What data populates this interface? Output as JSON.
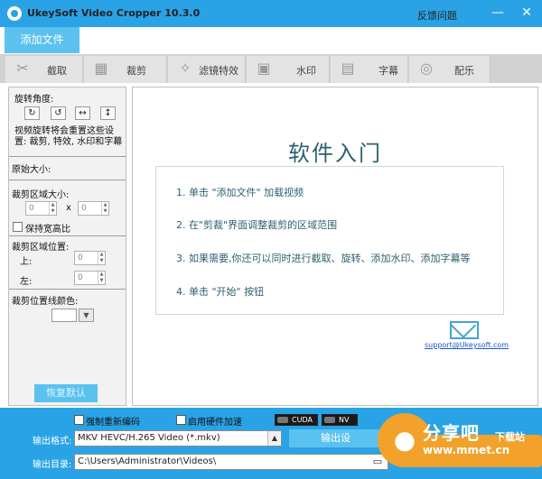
{
  "window": {
    "title": "UkeySoft Video Cropper 10.3.0",
    "feedback": "反馈问题",
    "minimize": "—",
    "close": "✕"
  },
  "toolbar": {
    "add_file": "添加文件"
  },
  "tabs": [
    {
      "label": "截取",
      "icon": "scissors-icon",
      "glyph": "✂"
    },
    {
      "label": "裁剪",
      "icon": "film-crop-icon",
      "glyph": "▦"
    },
    {
      "label": "滤镜特效",
      "icon": "sparkle-icon",
      "glyph": "✧"
    },
    {
      "label": "水印",
      "icon": "watermark-icon",
      "glyph": "▣"
    },
    {
      "label": "字幕",
      "icon": "subtitle-icon",
      "glyph": "▤"
    },
    {
      "label": "配乐",
      "icon": "music-icon",
      "glyph": "◎"
    }
  ],
  "left_panel": {
    "rotate_label": "旋转角度:",
    "rotate_buttons": [
      "↻",
      "↺",
      "↔",
      "↕"
    ],
    "rotate_note": "视频旋转将会重置这些设置: 裁剪, 特效, 水印和字幕",
    "original_size": "原始大小:",
    "crop_size": "裁剪区域大小:",
    "width_value": "0",
    "height_value": "0",
    "times": "x",
    "keep_ratio": "保持宽高比",
    "crop_position": "裁剪区域位置:",
    "top_label": "上:",
    "top_value": "0",
    "left_label": "左:",
    "left_value": "0",
    "line_color": "裁剪位置线颜色:",
    "reset": "恢复默认"
  },
  "intro": {
    "title": "软件入门",
    "steps": [
      "1. 单击 \"添加文件\" 加载视频",
      "2. 在\"剪裁\"界面调整裁剪的区域范围",
      "3. 如果需要,你还可以同时进行截取、旋转、添加水印、添加字幕等",
      "4. 单击 \"开始\" 按钮"
    ],
    "support": "support@Ukeysoft.com"
  },
  "bottom": {
    "force_reencode": "强制重新编码",
    "hw_accel": "启用硬件加速",
    "cuda": "CUDA",
    "nvenc": "NV",
    "format_label": "输出格式:",
    "format_value": "MKV HEVC/H.265 Video (*.mkv)",
    "output_settings": "输出设",
    "dir_label": "输出目录:",
    "dir_value": "C:\\Users\\Administrator\\Videos\\"
  },
  "watermark": {
    "name": "分享吧",
    "download": "下载站",
    "url": "www.mmet.cn"
  },
  "colors": {
    "accent": "#2aa3e6",
    "accent_light": "#5bc2f0",
    "tab_bg": "#e3e3e3",
    "watermark": "#f2a12a"
  }
}
